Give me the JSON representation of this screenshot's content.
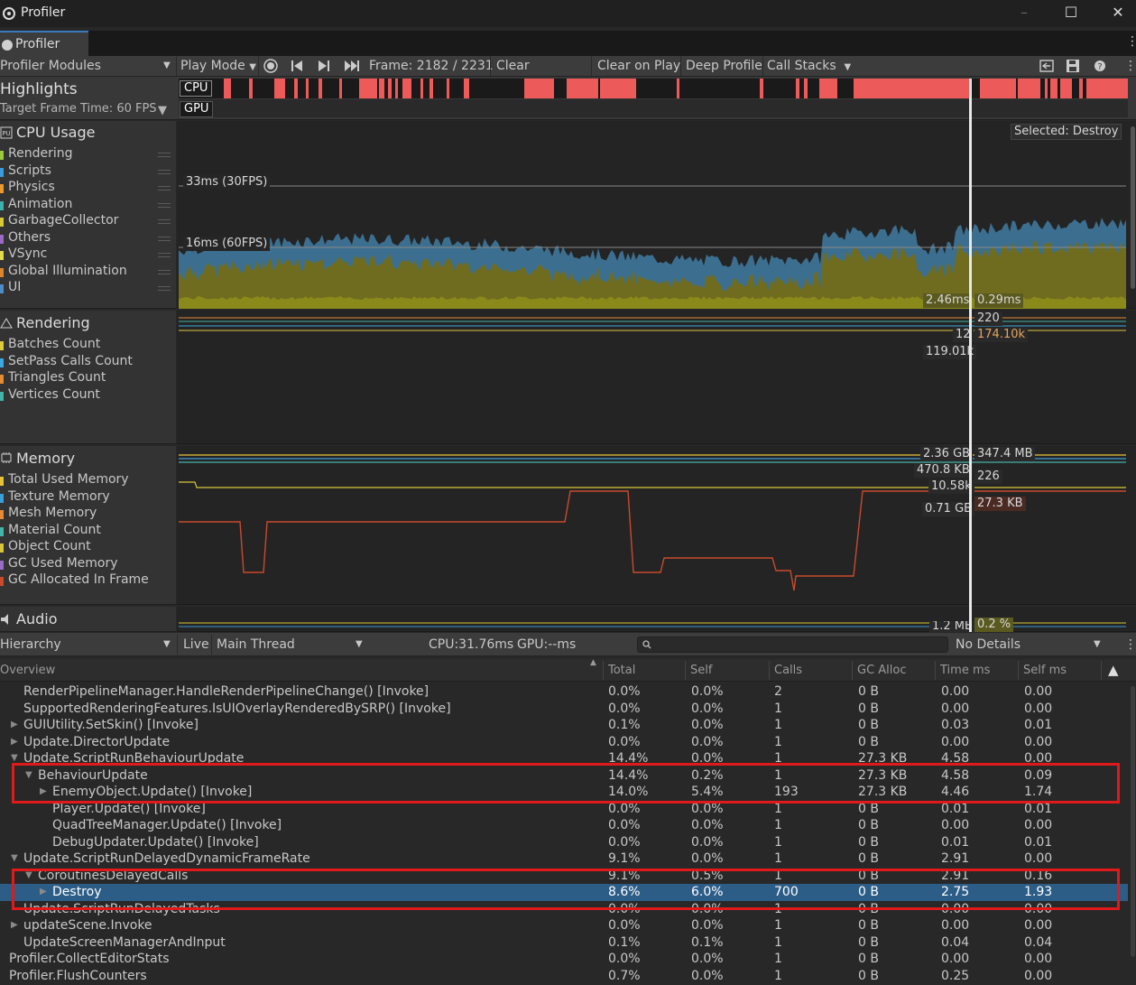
{
  "window": {
    "title": "Profiler",
    "tab": "Profiler"
  },
  "toolbar": {
    "modules": "Profiler Modules",
    "play_mode": "Play Mode",
    "frame": "Frame: 2182 / 2231",
    "clear": "Clear",
    "clear_on_play": "Clear on Play",
    "deep_profile": "Deep Profile",
    "call_stacks": "Call Stacks"
  },
  "highlights": {
    "title": "Highlights",
    "target": "Target Frame Time: 60 FPS",
    "cpu": "CPU",
    "gpu": "GPU"
  },
  "cpu_module": {
    "title": "CPU Usage",
    "items": [
      "Rendering",
      "Scripts",
      "Physics",
      "Animation",
      "GarbageCollector",
      "Others",
      "VSync",
      "Global Illumination",
      "UI"
    ],
    "colors": [
      "#9acb3d",
      "#3b9ad8",
      "#e89b2c",
      "#3fb0b0",
      "#d6c934",
      "#9b6ac4",
      "#e2d94e",
      "#dd8430",
      "#4e8cc6"
    ],
    "selected": "Selected: Destroy",
    "line30": "33ms (30FPS)",
    "line60": "16ms (60FPS)",
    "v1": "2.46ms",
    "v2": "0.29ms"
  },
  "rendering_module": {
    "title": "Rendering",
    "items": [
      "Batches Count",
      "SetPass Calls Count",
      "Triangles Count",
      "Vertices Count"
    ],
    "colors": [
      "#e2c93b",
      "#3ca7e0",
      "#e58b35",
      "#41b5a8"
    ],
    "v_batches": "220",
    "v_setpass": "12",
    "v_tris": "174.10k",
    "v_verts": "119.01k"
  },
  "memory_module": {
    "title": "Memory",
    "items": [
      "Total Used Memory",
      "Texture Memory",
      "Mesh Memory",
      "Material Count",
      "Object Count",
      "GC Used Memory",
      "GC Allocated In Frame"
    ],
    "colors": [
      "#e6c23a",
      "#3c9ed8",
      "#e58b35",
      "#43b5a8",
      "#d8c63a",
      "#9a6bc2",
      "#c94a2d"
    ],
    "v_total": "2.36 GB",
    "v_texture": "347.4 MB",
    "v_mesh": "470.8 KB",
    "v_material": "226",
    "v_object": "10.58k",
    "v_gcused": "0.71 GB",
    "v_gcalloc": "27.3 KB"
  },
  "audio_module": {
    "title": "Audio",
    "v1": "1.2 MB",
    "v2": "0.2 %"
  },
  "hierarchy_bar": {
    "view": "Hierarchy",
    "live": "Live",
    "thread": "Main Thread",
    "cpu": "CPU:31.76ms",
    "gpu": "GPU:--ms",
    "details": "No Details"
  },
  "table": {
    "columns": [
      "Overview",
      "Total",
      "Self",
      "Calls",
      "GC Alloc",
      "Time ms",
      "Self ms"
    ],
    "rows": [
      {
        "indent": 1,
        "arrow": "",
        "name": "RenderPipelineManager.HandleRenderPipelineChange() [Invoke]",
        "total": "0.0%",
        "self": "0.0%",
        "calls": "2",
        "gc": "0 B",
        "time": "0.00",
        "selfms": "0.00"
      },
      {
        "indent": 1,
        "arrow": "",
        "name": "SupportedRenderingFeatures.IsUIOverlayRenderedBySRP() [Invoke]",
        "total": "0.0%",
        "self": "0.0%",
        "calls": "1",
        "gc": "0 B",
        "time": "0.00",
        "selfms": "0.00"
      },
      {
        "indent": 1,
        "arrow": "▶",
        "name": "GUIUtility.SetSkin() [Invoke]",
        "total": "0.1%",
        "self": "0.0%",
        "calls": "1",
        "gc": "0 B",
        "time": "0.03",
        "selfms": "0.01"
      },
      {
        "indent": 1,
        "arrow": "▶",
        "name": "Update.DirectorUpdate",
        "total": "0.0%",
        "self": "0.0%",
        "calls": "1",
        "gc": "0 B",
        "time": "0.00",
        "selfms": "0.00"
      },
      {
        "indent": 1,
        "arrow": "▼",
        "name": "Update.ScriptRunBehaviourUpdate",
        "total": "14.4%",
        "self": "0.0%",
        "calls": "1",
        "gc": "27.3 KB",
        "time": "4.58",
        "selfms": "0.00"
      },
      {
        "indent": 2,
        "arrow": "▼",
        "name": "BehaviourUpdate",
        "total": "14.4%",
        "self": "0.2%",
        "calls": "1",
        "gc": "27.3 KB",
        "time": "4.58",
        "selfms": "0.09"
      },
      {
        "indent": 3,
        "arrow": "▶",
        "name": "EnemyObject.Update() [Invoke]",
        "total": "14.0%",
        "self": "5.4%",
        "calls": "193",
        "gc": "27.3 KB",
        "time": "4.46",
        "selfms": "1.74"
      },
      {
        "indent": 3,
        "arrow": "",
        "name": "Player.Update() [Invoke]",
        "total": "0.0%",
        "self": "0.0%",
        "calls": "1",
        "gc": "0 B",
        "time": "0.01",
        "selfms": "0.01"
      },
      {
        "indent": 3,
        "arrow": "",
        "name": "QuadTreeManager.Update() [Invoke]",
        "total": "0.0%",
        "self": "0.0%",
        "calls": "1",
        "gc": "0 B",
        "time": "0.00",
        "selfms": "0.00"
      },
      {
        "indent": 3,
        "arrow": "",
        "name": "DebugUpdater.Update() [Invoke]",
        "total": "0.0%",
        "self": "0.0%",
        "calls": "1",
        "gc": "0 B",
        "time": "0.01",
        "selfms": "0.01"
      },
      {
        "indent": 1,
        "arrow": "▼",
        "name": "Update.ScriptRunDelayedDynamicFrameRate",
        "total": "9.1%",
        "self": "0.0%",
        "calls": "1",
        "gc": "0 B",
        "time": "2.91",
        "selfms": "0.00"
      },
      {
        "indent": 2,
        "arrow": "▼",
        "name": "CoroutinesDelayedCalls",
        "total": "9.1%",
        "self": "0.5%",
        "calls": "1",
        "gc": "0 B",
        "time": "2.91",
        "selfms": "0.16"
      },
      {
        "indent": 3,
        "arrow": "▶",
        "name": "Destroy",
        "total": "8.6%",
        "self": "6.0%",
        "calls": "700",
        "gc": "0 B",
        "time": "2.75",
        "selfms": "1.93",
        "selected": true
      },
      {
        "indent": 1,
        "arrow": "",
        "name": "Update.ScriptRunDelayedTasks",
        "total": "0.0%",
        "self": "0.0%",
        "calls": "1",
        "gc": "0 B",
        "time": "0.00",
        "selfms": "0.00"
      },
      {
        "indent": 1,
        "arrow": "▶",
        "name": "updateScene.Invoke",
        "total": "0.0%",
        "self": "0.0%",
        "calls": "1",
        "gc": "0 B",
        "time": "0.00",
        "selfms": "0.00"
      },
      {
        "indent": 1,
        "arrow": "",
        "name": "UpdateScreenManagerAndInput",
        "total": "0.1%",
        "self": "0.1%",
        "calls": "1",
        "gc": "0 B",
        "time": "0.04",
        "selfms": "0.04"
      },
      {
        "indent": 0,
        "arrow": "",
        "name": "Profiler.CollectEditorStats",
        "total": "0.0%",
        "self": "0.0%",
        "calls": "1",
        "gc": "0 B",
        "time": "0.00",
        "selfms": "0.00"
      },
      {
        "indent": 0,
        "arrow": "",
        "name": "Profiler.FlushCounters",
        "total": "0.7%",
        "self": "0.0%",
        "calls": "1",
        "gc": "0 B",
        "time": "0.25",
        "selfms": "0.00"
      }
    ]
  }
}
